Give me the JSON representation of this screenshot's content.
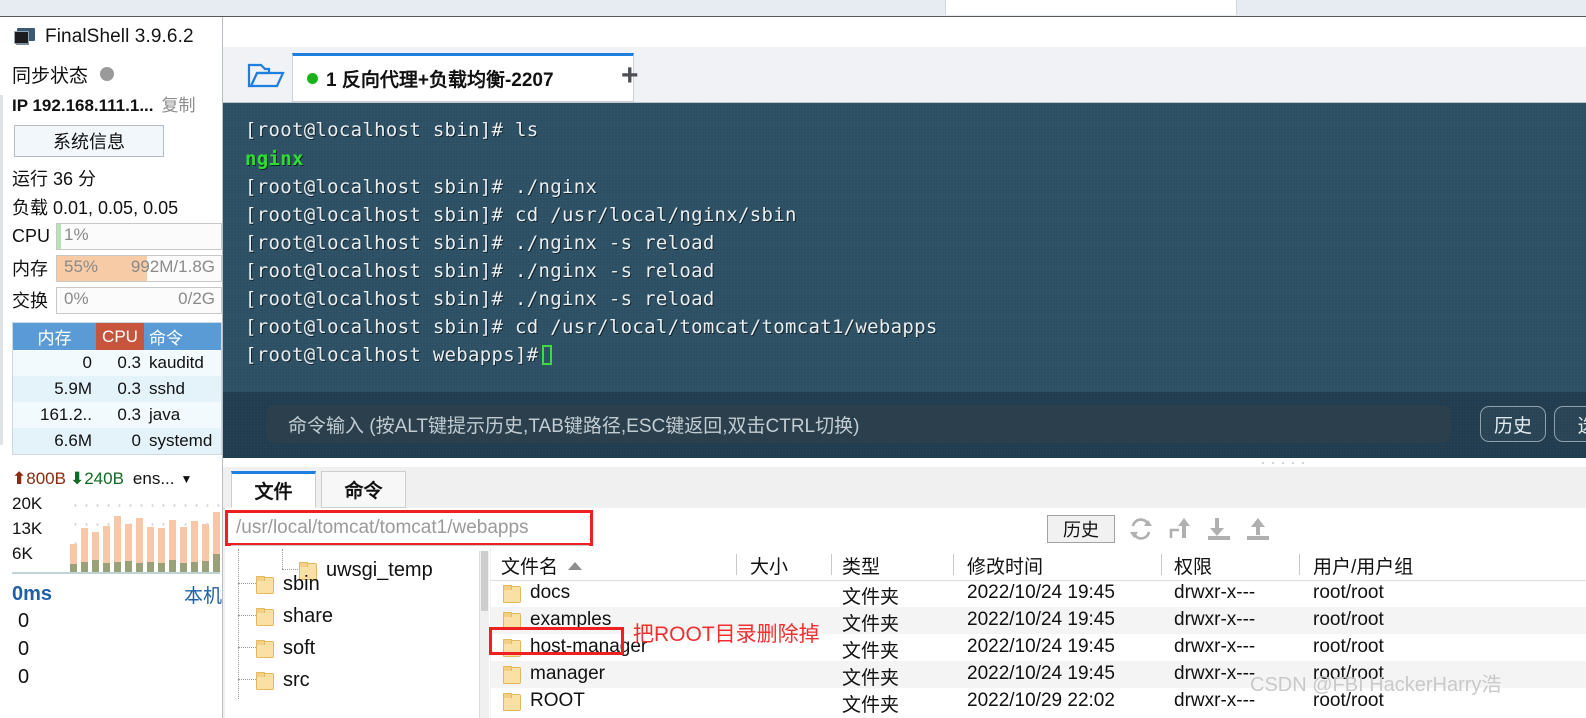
{
  "app": {
    "title": "FinalShell 3.9.6.2",
    "icon": "monitor-icon"
  },
  "sidebar": {
    "sync_label": "同步状态",
    "sync_status_icon": "status-dot-grey",
    "ip_label": "IP 192.168.111.1...",
    "copy_label": "复制",
    "sysinfo_button": "系统信息",
    "uptime": "运行 36 分",
    "load": "负载 0.01, 0.05, 0.05",
    "meters": [
      {
        "name": "CPU",
        "left": "1%",
        "right": "",
        "percent": 1,
        "color": "#b9e2b9"
      },
      {
        "name": "内存",
        "left": "55%",
        "right": "992M/1.8G",
        "percent": 55,
        "color": "#f7cba6"
      },
      {
        "name": "交换",
        "left": "0%",
        "right": "0/2G",
        "percent": 0,
        "color": "#f7cba6"
      }
    ],
    "proc_tabs": [
      {
        "label": "内存",
        "selected": false
      },
      {
        "label": "CPU",
        "selected": true
      },
      {
        "label": "命令",
        "selected": false
      }
    ],
    "proc_columns": [
      "内存",
      "CPU",
      "命令"
    ],
    "processes": [
      {
        "mem": "0",
        "cpu": "0.3",
        "cmd": "kauditd",
        "mem_bar": 0,
        "cpu_bar": 3
      },
      {
        "mem": "5.9M",
        "cpu": "0.3",
        "cmd": "sshd",
        "mem_bar": 3,
        "cpu_bar": 3
      },
      {
        "mem": "161.2..",
        "cpu": "0.3",
        "cmd": "java",
        "mem_bar": 11,
        "cpu_bar": 3
      },
      {
        "mem": "6.6M",
        "cpu": "0",
        "cmd": "systemd",
        "mem_bar": 3,
        "cpu_bar": 0
      }
    ],
    "net": {
      "up_icon": "arrow-up-icon",
      "up": "800B",
      "down_icon": "arrow-down-icon",
      "down": "240B",
      "interface": "ens...",
      "caret_icon": "chevron-down-icon",
      "y_labels": [
        "20K",
        "13K",
        "6K"
      ]
    },
    "ping": {
      "value": "0ms",
      "host": "本机",
      "y_labels": [
        "0",
        "0",
        "0"
      ]
    }
  },
  "terminal": {
    "folder_icon": "open-folder-icon",
    "tab": {
      "status_icon": "connected-dot",
      "label": "1 反向代理+负载均衡-2207",
      "close_icon": "close-icon"
    },
    "new_tab_icon": "plus-icon",
    "lines": [
      {
        "text": "[root@localhost sbin]# ls",
        "style": "normal"
      },
      {
        "text": "nginx",
        "style": "green"
      },
      {
        "text": "[root@localhost sbin]# ./nginx",
        "style": "normal"
      },
      {
        "text": "[root@localhost sbin]# cd /usr/local/nginx/sbin",
        "style": "normal"
      },
      {
        "text": "[root@localhost sbin]# ./nginx -s reload",
        "style": "normal"
      },
      {
        "text": "[root@localhost sbin]# ./nginx -s reload",
        "style": "normal"
      },
      {
        "text": "[root@localhost sbin]# ./nginx -s reload",
        "style": "normal"
      },
      {
        "text": "[root@localhost sbin]# cd /usr/local/tomcat/tomcat1/webapps",
        "style": "normal"
      },
      {
        "text": "[root@localhost webapps]#",
        "style": "cursor"
      }
    ],
    "command_placeholder": "命令输入 (按ALT键提示历史,TAB键路径,ESC键返回,双击CTRL切换)",
    "history_button": "历史",
    "extra_button": "选"
  },
  "file_panel": {
    "tabs": [
      {
        "label": "文件",
        "selected": true
      },
      {
        "label": "命令",
        "selected": false
      }
    ],
    "path": "/usr/local/tomcat/tomcat1/webapps",
    "history_button": "历史",
    "toolbar_icons": [
      "refresh-icon",
      "parent-dir-icon",
      "download-icon",
      "upload-icon"
    ],
    "tree": [
      {
        "label": "uwsgi_temp",
        "depth": 2
      },
      {
        "label": "sbin",
        "depth": 1
      },
      {
        "label": "share",
        "depth": 1
      },
      {
        "label": "soft",
        "depth": 1
      },
      {
        "label": "src",
        "depth": 1
      }
    ],
    "columns": [
      "文件名",
      "大小",
      "类型",
      "修改时间",
      "权限",
      "用户/用户组"
    ],
    "sort_icon": "sort-asc-icon",
    "rows": [
      {
        "name": "docs",
        "size": "",
        "type": "文件夹",
        "mtime": "2022/10/24 19:45",
        "perm": "drwxr-x---",
        "owner": "root/root"
      },
      {
        "name": "examples",
        "size": "",
        "type": "文件夹",
        "mtime": "2022/10/24 19:45",
        "perm": "drwxr-x---",
        "owner": "root/root"
      },
      {
        "name": "host-manager",
        "size": "",
        "type": "文件夹",
        "mtime": "2022/10/24 19:45",
        "perm": "drwxr-x---",
        "owner": "root/root"
      },
      {
        "name": "manager",
        "size": "",
        "type": "文件夹",
        "mtime": "2022/10/24 19:45",
        "perm": "drwxr-x---",
        "owner": "root/root"
      },
      {
        "name": "ROOT",
        "size": "",
        "type": "文件夹",
        "mtime": "2022/10/29 22:02",
        "perm": "drwxr-x---",
        "owner": "root/root"
      }
    ]
  },
  "annotations": {
    "delete_root_note": "把ROOT目录删除掉",
    "watermark": "CSDN @FBI HackerHarry浩",
    "highlight_color": "#ee2020"
  }
}
